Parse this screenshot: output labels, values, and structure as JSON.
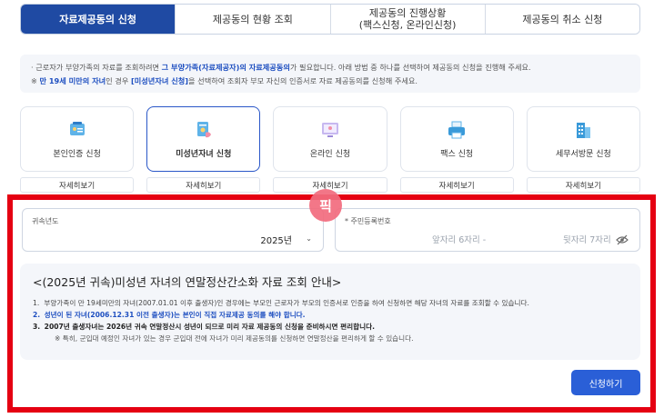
{
  "tabs": [
    {
      "label": "자료제공동의 신청"
    },
    {
      "label": "제공동의 현황 조회"
    },
    {
      "label": "제공동의 진행상황\n(팩스신청, 온라인신청)"
    },
    {
      "label": "제공동의 취소 신청"
    }
  ],
  "notice": {
    "line1_pre": "· 근로자가 부양가족의 자료를 조회하려면 ",
    "line1_hl": "그 부양가족(자료제공자)의 자료제공동의",
    "line1_post": "가 필요합니다. 아래 방법 중 하나를 선택하여 제공동의 신청을 진행해 주세요.",
    "line2_pre": "※ ",
    "line2_hl": "만 19세 미만의 자녀",
    "line2_mid": "인 경우 ",
    "line2_hl2": "[미성년자녀 신청]",
    "line2_post": "을 선택하여 조회자 부모 자신의 인증서로 자료 제공동의를 신청해 주세요."
  },
  "methods": [
    {
      "label": "본인인증 신청",
      "icon": "id-card-icon",
      "more": "자세히보기"
    },
    {
      "label": "미성년자녀 신청",
      "icon": "child-document-icon",
      "more": "자세히보기"
    },
    {
      "label": "온라인 신청",
      "icon": "monitor-icon",
      "more": "자세히보기"
    },
    {
      "label": "팩스 신청",
      "icon": "fax-printer-icon",
      "more": "자세히보기"
    },
    {
      "label": "세무서방문 신청",
      "icon": "office-building-icon",
      "more": "자세히보기"
    }
  ],
  "watermark": "픽",
  "form": {
    "year_label": "귀속년도",
    "year_value": "2025년",
    "ssn_label": "* 주민등록번호",
    "ssn_front_placeholder": "앞자리 6자리 -",
    "ssn_back_placeholder": "뒷자리 7자리"
  },
  "info": {
    "title": "<(2025년 귀속)미성년 자녀의 연말정산간소화 자료 조회 안내>",
    "items": [
      {
        "num": "1.",
        "text": "부양가족이 만 19세미만의 자녀(2007.01.01 이후 출생자)인 경우에는 부모인 근로자가 부모의 인증서로 인증을 하여 신청하면 해당 자녀의 자료를 조회할 수 있습니다."
      },
      {
        "num": "2.",
        "text": "성년이 된 자녀(2006.12.31 이전 출생자)는 본인이 직접 자료제공 동의를 해야 합니다."
      },
      {
        "num": "3.",
        "text": "2007년 출생자녀는 2026년 귀속 연말정산시 성년이 되므로 미리 자료 제공동의 신청을 준비하시면 편리합니다."
      }
    ],
    "sub_note": "※ 특히, 군입대 예정인 자녀가 있는 경우 군입대 전에 자녀가 미리 제공동의를 신청하면 연말정산을 편리하게 할 수 있습니다."
  },
  "submit_label": "신청하기",
  "colors": {
    "primary": "#1f4aa3",
    "accent_blue": "#2a5fd7",
    "highlight_red": "#e50012"
  }
}
